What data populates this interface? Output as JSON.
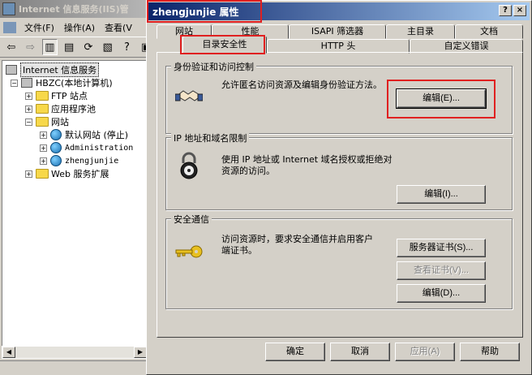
{
  "background_window": {
    "title": "Internet 信息服务(IIS)管",
    "menu": [
      "文件(F)",
      "操作(A)",
      "查看(V"
    ],
    "tree": {
      "root": "Internet 信息服务",
      "server": "HBZC(本地计算机)",
      "ftp": "FTP 站点",
      "app_pools": "应用程序池",
      "websites": "网站",
      "default_site": "默认网站 (停止)",
      "admin_site": "Administration",
      "user_site": "zhengjunjie",
      "web_ext": "Web 服务扩展"
    }
  },
  "dialog": {
    "title": "zhengjunjie 属性",
    "tabs_row1": [
      "网站",
      "性能",
      "ISAPI 筛选器",
      "主目录",
      "文档"
    ],
    "tabs_row2": [
      "目录安全性",
      "HTTP 头",
      "自定义错误"
    ],
    "active_tab": "目录安全性",
    "auth": {
      "legend": "身份验证和访问控制",
      "desc": "允许匿名访问资源及编辑身份验证方法。",
      "edit_button": "编辑(E)..."
    },
    "ip": {
      "legend": "IP 地址和域名限制",
      "desc": "使用 IP 地址或 Internet 域名授权或拒绝对资源的访问。",
      "edit_button": "编辑(I)..."
    },
    "secure": {
      "legend": "安全通信",
      "desc": "访问资源时，要求安全通信并启用客户端证书。",
      "server_cert_button": "服务器证书(S)...",
      "view_cert_button": "查看证书(V)...",
      "edit_button": "编辑(D)..."
    },
    "buttons": {
      "ok": "确定",
      "cancel": "取消",
      "apply": "应用(A)",
      "help": "帮助"
    }
  },
  "colors": {
    "title_active": "#0a246a",
    "highlight_red": "#e02020",
    "face": "#d4d0c8"
  }
}
